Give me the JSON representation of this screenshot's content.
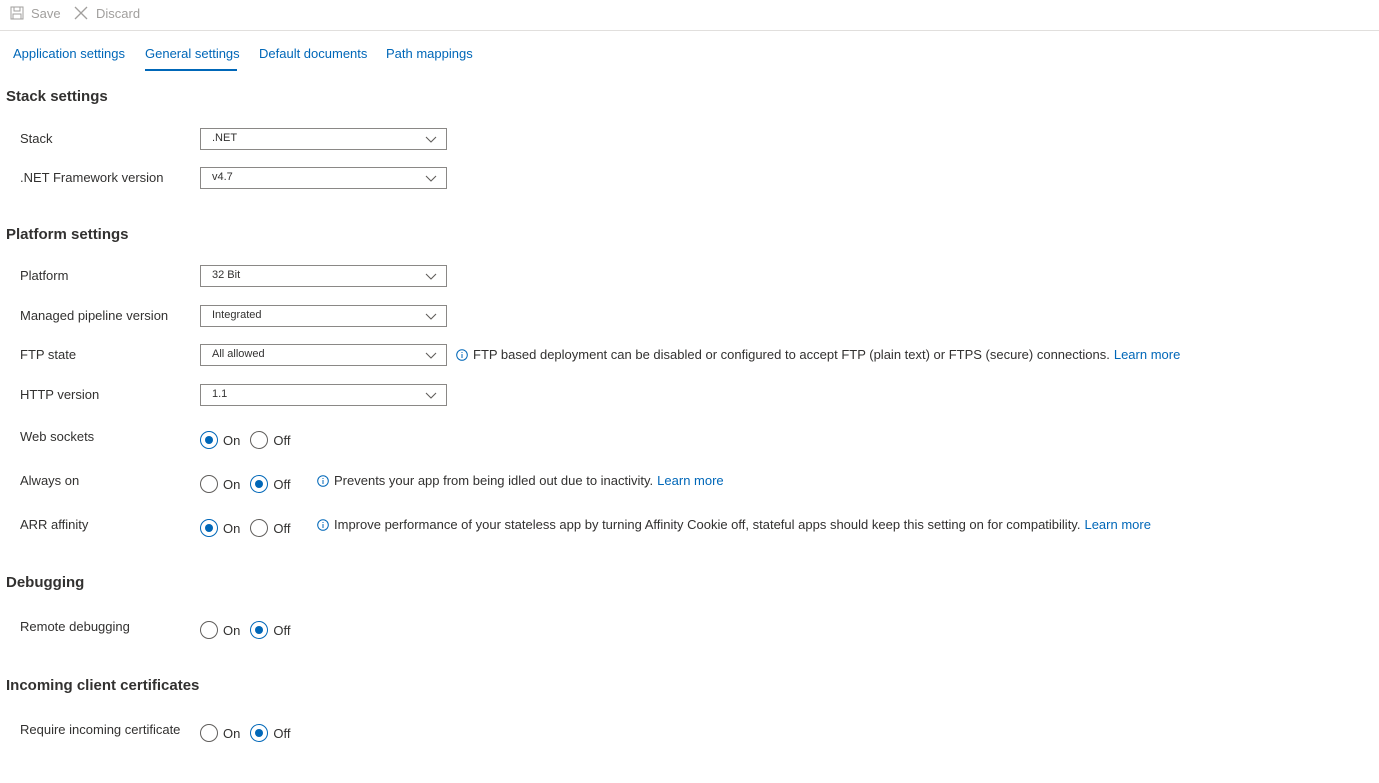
{
  "commandbar": {
    "save_label": "Save",
    "discard_label": "Discard"
  },
  "tabs": [
    {
      "label": "Application settings"
    },
    {
      "label": "General settings",
      "active": true
    },
    {
      "label": "Default documents"
    },
    {
      "label": "Path mappings"
    }
  ],
  "sections": {
    "stack": {
      "title": "Stack settings",
      "stack_label": "Stack",
      "stack_value": ".NET",
      "framework_label": ".NET Framework version",
      "framework_value": "v4.7"
    },
    "platform": {
      "title": "Platform settings",
      "platform_label": "Platform",
      "platform_value": "32 Bit",
      "pipeline_label": "Managed pipeline version",
      "pipeline_value": "Integrated",
      "ftp_label": "FTP state",
      "ftp_value": "All allowed",
      "ftp_info": "FTP based deployment can be disabled or configured to accept FTP (plain text) or FTPS (secure) connections.",
      "ftp_link": "Learn more",
      "http_label": "HTTP version",
      "http_value": "1.1",
      "websockets_label": "Web sockets",
      "websockets_selected": "On",
      "alwayson_label": "Always on",
      "alwayson_selected": "Off",
      "alwayson_info": "Prevents your app from being idled out due to inactivity.",
      "alwayson_link": "Learn more",
      "arr_label": "ARR affinity",
      "arr_selected": "On",
      "arr_info": "Improve performance of your stateless app by turning Affinity Cookie off, stateful apps should keep this setting on for compatibility.",
      "arr_link": "Learn more"
    },
    "debugging": {
      "title": "Debugging",
      "remote_label": "Remote debugging",
      "remote_selected": "Off"
    },
    "certs": {
      "title": "Incoming client certificates",
      "require_label": "Require incoming certificate",
      "require_selected": "Off"
    }
  },
  "radio_options": {
    "on": "On",
    "off": "Off"
  },
  "colors": {
    "accent": "#0067b8",
    "text": "#323130",
    "disabled": "#a19f9d",
    "border": "#8a8886"
  }
}
